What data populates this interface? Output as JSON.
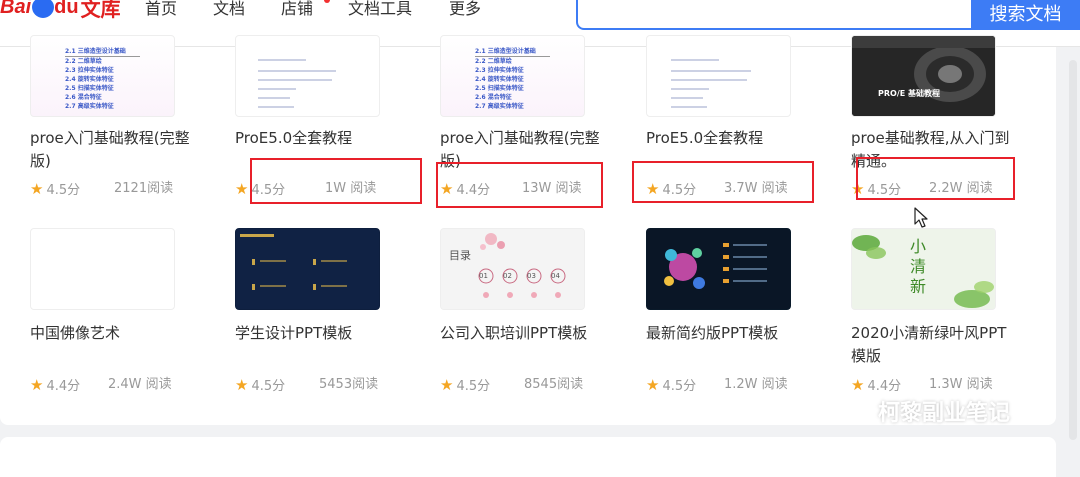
{
  "header": {
    "logo": {
      "bai": "Bai",
      "du": "du",
      "wenku": "文库"
    },
    "nav": [
      "首页",
      "文档",
      "店铺",
      "文档工具",
      "更多"
    ],
    "search_button": "搜索文档"
  },
  "colors": {
    "accent": "#3d7cf5",
    "highlight_box": "#e8202a",
    "star": "#f4a623"
  },
  "row1": [
    {
      "title": "proe入门基础教程(完整版)",
      "rating": "4.5分",
      "reads": "2121阅读",
      "thumb_lines": [
        "2.1 三维造型设计基础",
        "2.2 二维草绘",
        "2.3 拉伸实体特征",
        "2.4 旋转实体特征",
        "2.5 扫描实体特征",
        "2.6 混合特征",
        "2.7 高级实体特征"
      ]
    },
    {
      "title": "ProE5.0全套教程",
      "rating": "4.5分",
      "reads": "1W 阅读"
    },
    {
      "title": "proe入门基础教程(完整版)",
      "rating": "4.4分",
      "reads": "13W 阅读",
      "thumb_lines": [
        "2.1 三维造型设计基础",
        "2.2 二维草绘",
        "2.3 拉伸实体特征",
        "2.4 旋转实体特征",
        "2.5 扫描实体特征",
        "2.6 混合特征",
        "2.7 高级实体特征"
      ]
    },
    {
      "title": "ProE5.0全套教程",
      "rating": "4.5分",
      "reads": "3.7W 阅读"
    },
    {
      "title": "proe基础教程,从入门到精通。",
      "rating": "4.5分",
      "reads": "2.2W 阅读",
      "thumb_caption": "PRO/E 基础教程"
    }
  ],
  "row2": [
    {
      "title": "中国佛像艺术",
      "rating": "4.4分",
      "reads": "2.4W 阅读"
    },
    {
      "title": "学生设计PPT模板",
      "rating": "4.5分",
      "reads": "5453阅读"
    },
    {
      "title": "公司入职培训PPT模板",
      "rating": "4.5分",
      "reads": "8545阅读",
      "thumb_caption": "目录",
      "thumb_nums": [
        "01",
        "02",
        "03",
        "04"
      ]
    },
    {
      "title": "最新简约版PPT模板",
      "rating": "4.5分",
      "reads": "1.2W 阅读"
    },
    {
      "title": "2020小清新绿叶风PPT模版",
      "rating": "4.4分",
      "reads": "1.3W 阅读",
      "thumb_caption": "小清新"
    }
  ],
  "watermark": "柯黎副业笔记"
}
